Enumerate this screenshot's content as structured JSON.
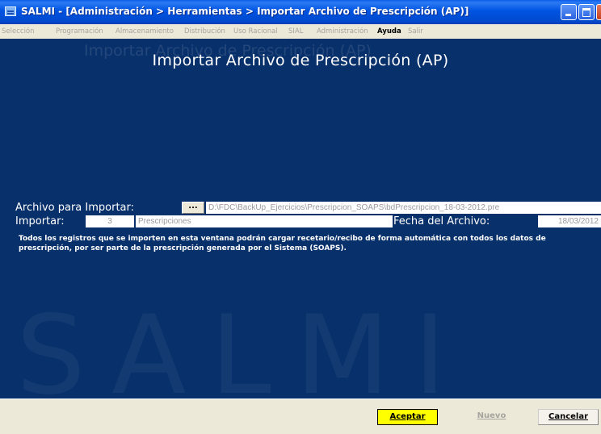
{
  "window": {
    "title": "SALMI - [Administración > Herramientas > Importar Archivo de Prescripción (AP)]"
  },
  "menu": [
    {
      "label": "Selección",
      "enabled": false
    },
    {
      "label": "Programación",
      "enabled": false
    },
    {
      "label": "Almacenamiento",
      "enabled": false
    },
    {
      "label": "Distribución",
      "enabled": false
    },
    {
      "label": "Uso Racional",
      "enabled": false
    },
    {
      "label": "SIAL",
      "enabled": false
    },
    {
      "label": "Administración",
      "enabled": false
    },
    {
      "label": "Ayuda",
      "enabled": true
    },
    {
      "label": "Salir",
      "enabled": false
    }
  ],
  "page": {
    "heading": "Importar Archivo de Prescripción (AP)",
    "watermark_heading": "Importar Archivo de Prescripción (AP)",
    "watermark_logo": "SALMI"
  },
  "form": {
    "archivo_label": "Archivo para Importar:",
    "browse_label": "...",
    "archivo_value": "D:\\FDC\\BackUp_Ejercicios\\Prescripcion_SOAPS\\bdPrescripcion_18-03-2012.pre",
    "importar_label": "Importar:",
    "count_value": "3",
    "count_unit": "Prescripciones",
    "fecha_label": "Fecha del Archivo:",
    "fecha_value": "18/03/2012"
  },
  "note": "Todos los registros que se importen en esta ventana podrán cargar recetario/recibo de forma automática con todos los datos de prescripción, por  ser parte de la prescripción generada por el Sistema (SOAPS).",
  "buttons": {
    "aceptar": "Aceptar",
    "nuevo": "Nuevo",
    "cancelar": "Cancelar"
  },
  "colors": {
    "panel_background": "#08306B",
    "highlight_button": "#FFFF00",
    "disabled_text": "#A7A4A0"
  }
}
